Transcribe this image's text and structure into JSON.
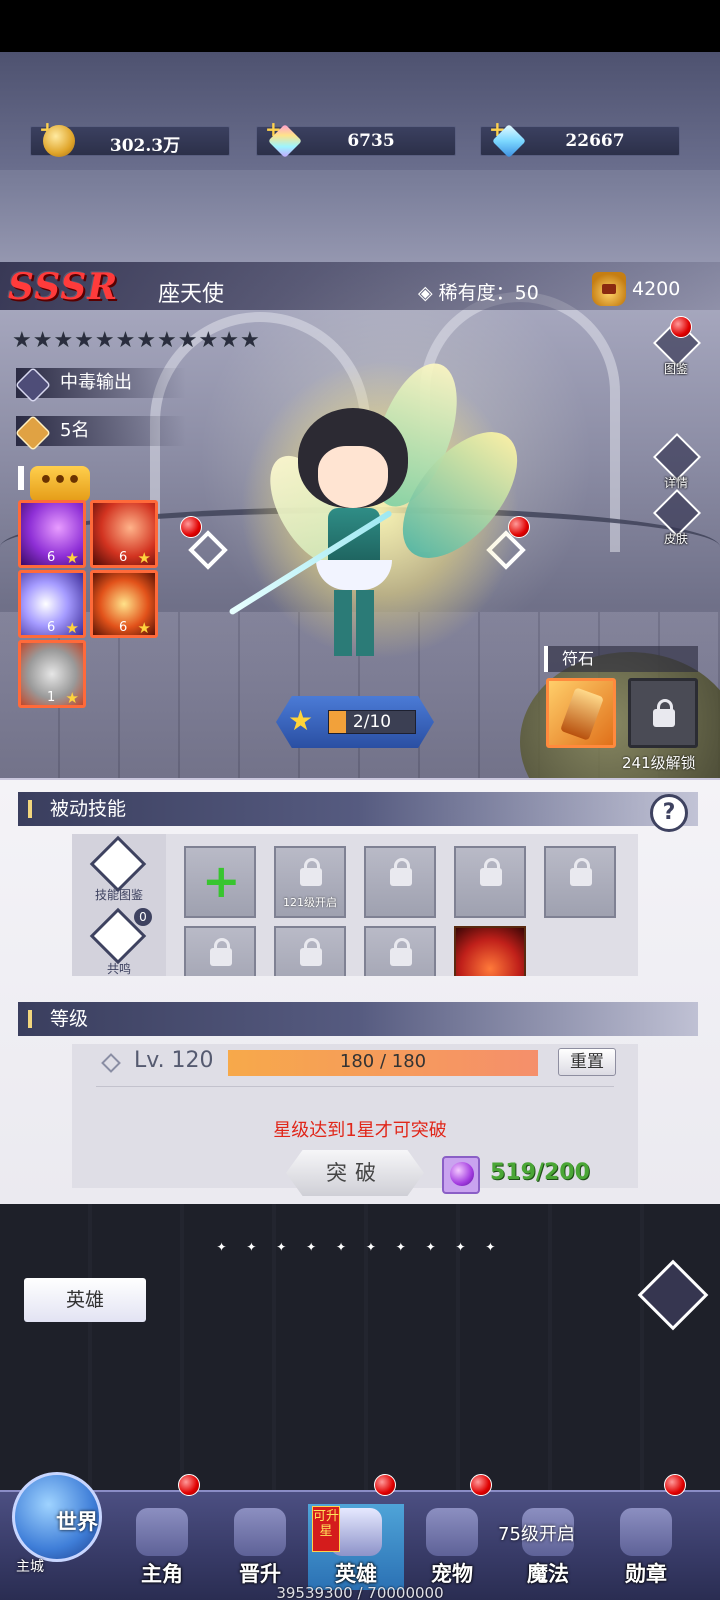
{
  "currencies": [
    {
      "name": "gold",
      "value": "302.3万"
    },
    {
      "name": "rainbow-gem",
      "value": "6735"
    },
    {
      "name": "diamond",
      "value": "22667"
    }
  ],
  "hero": {
    "rarity_tier": "SSSR",
    "name": "座天使",
    "rarity_label": "稀有度：50",
    "power": "4200",
    "stars": "★★★★★★★★★★★★",
    "role_tag": "中毒输出",
    "rank_tag": "5名",
    "level_progress": "2/10",
    "level_progress_fraction": 0.2
  },
  "active_skills": [
    {
      "level": "6",
      "color": "#8e2fd6"
    },
    {
      "level": "6",
      "color": "#d23320"
    },
    {
      "level": "6",
      "color": "#6c5fd9"
    },
    {
      "level": "6",
      "color": "#e2521a"
    },
    {
      "level": "1",
      "color": "#c2c2c2"
    }
  ],
  "side_buttons": {
    "codex": "图鉴",
    "details": "详情",
    "skin": "皮肤"
  },
  "rune": {
    "title": "符石",
    "unlock_text": "241级解锁"
  },
  "passive": {
    "title": "被动技能",
    "skill_codex": "技能图鉴",
    "resonance": "共鸣",
    "resonance_count": "0",
    "slot_unlock_121": "121级开启"
  },
  "level_section": {
    "title": "等级",
    "level": "Lv. 120",
    "exp": "180 / 180",
    "reset": "重置",
    "warning": "星级达到1星才可突破",
    "breakthrough": "突破",
    "material_count": "519/200"
  },
  "bottom": {
    "hero_tab": "英雄",
    "dots": "✦ ✦ ✦ ✦ ✦ ✦ ✦ ✦ ✦ ✦"
  },
  "nav": {
    "world": "世界",
    "main_city": "主城",
    "items": [
      "主角",
      "晋升",
      "英雄",
      "宠物",
      "魔法",
      "勋章"
    ],
    "upgradable_tag": "可升星",
    "magic_lock": "75级开启",
    "exp_footer": "39539300 / 70000000"
  },
  "colors": {
    "sssr": "#ff3b3b",
    "warning": "#e0271a",
    "material_ok": "#4aa636"
  }
}
